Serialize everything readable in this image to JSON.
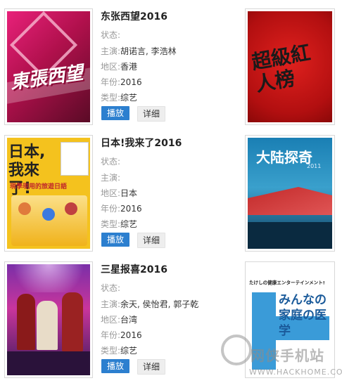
{
  "labels": {
    "status": "状态:",
    "cast": "主演:",
    "region": "地区:",
    "year": "年份:",
    "genre": "类型:",
    "play": "播放",
    "detail": "详细"
  },
  "items": [
    {
      "title": "东张西望2016",
      "status": "",
      "cast": "胡诺言, 李浩林",
      "region": "香港",
      "year": "2016",
      "genre": "综艺",
      "poster_text": "東張西望"
    },
    {
      "title": "日本!我来了2016",
      "status": "",
      "cast": "",
      "region": "日本",
      "year": "2016",
      "genre": "综艺",
      "poster_text": "日本,我來了!",
      "poster_sub": "現學現用的旅遊日語"
    },
    {
      "title": "三星报喜2016",
      "status": "",
      "cast": "余天, 侯怡君, 郭子乾",
      "region": "台湾",
      "year": "2016",
      "genre": "综艺"
    }
  ],
  "side": [
    {
      "poster_text": "超級紅人榜"
    },
    {
      "poster_text": "大陆探奇",
      "poster_sub": "2011"
    },
    {
      "poster_text": "みんなの家庭の医学",
      "poster_sub": "たけしの健康エンターテインメント!"
    }
  ],
  "watermark": {
    "text": "网侠手机站",
    "url": "WWW.HACKHOME.COM"
  }
}
